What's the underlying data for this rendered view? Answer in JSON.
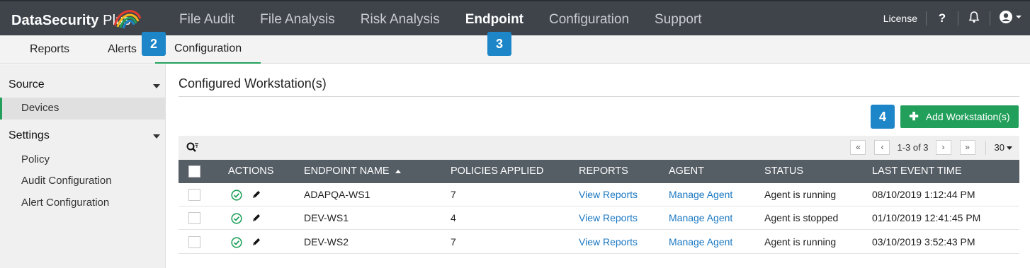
{
  "app": {
    "logo_text": "DataSecurity",
    "logo_suffix": "Plus"
  },
  "topnav": {
    "items": [
      "File Audit",
      "File Analysis",
      "Risk Analysis",
      "Endpoint",
      "Configuration",
      "Support"
    ],
    "active": "Endpoint",
    "license_label": "License",
    "help_label": "?"
  },
  "subnav": {
    "items": [
      "Reports",
      "Alerts",
      "Configuration"
    ],
    "active": "Configuration"
  },
  "badges": {
    "b2": "2",
    "b3": "3",
    "b4": "4"
  },
  "sidebar": {
    "source_label": "Source",
    "devices_label": "Devices",
    "settings_label": "Settings",
    "policy_label": "Policy",
    "audit_config_label": "Audit Configuration",
    "alert_config_label": "Alert Configuration"
  },
  "main": {
    "title": "Configured Workstation(s)",
    "add_button_label": "Add Workstation(s)",
    "pager": {
      "range": "1-3 of 3",
      "page_size": "30",
      "first": "«",
      "prev": "‹",
      "next": "›",
      "last": "»"
    }
  },
  "table": {
    "headers": {
      "actions": "ACTIONS",
      "endpoint_name": "ENDPOINT NAME",
      "policies_applied": "POLICIES APPLIED",
      "reports": "REPORTS",
      "agent": "AGENT",
      "status": "STATUS",
      "last_event_time": "LAST EVENT TIME"
    },
    "rows": [
      {
        "endpoint": "ADAPQA-WS1",
        "policies": "7",
        "reports": "View Reports",
        "agent": "Manage Agent",
        "status": "Agent is running",
        "last_event": "08/10/2019 1:12:44 PM"
      },
      {
        "endpoint": "DEV-WS1",
        "policies": "4",
        "reports": "View Reports",
        "agent": "Manage Agent",
        "status": "Agent is stopped",
        "last_event": "01/10/2019 12:41:45 PM"
      },
      {
        "endpoint": "DEV-WS2",
        "policies": "7",
        "reports": "View Reports",
        "agent": "Manage Agent",
        "status": "Agent is running",
        "last_event": "03/10/2019 3:52:43 PM"
      }
    ]
  },
  "colors": {
    "accent_green": "#22a05b",
    "link_blue": "#1a78c2",
    "badge_blue": "#1d86c8",
    "topbar": "#3f444b",
    "table_header": "#555d65"
  }
}
